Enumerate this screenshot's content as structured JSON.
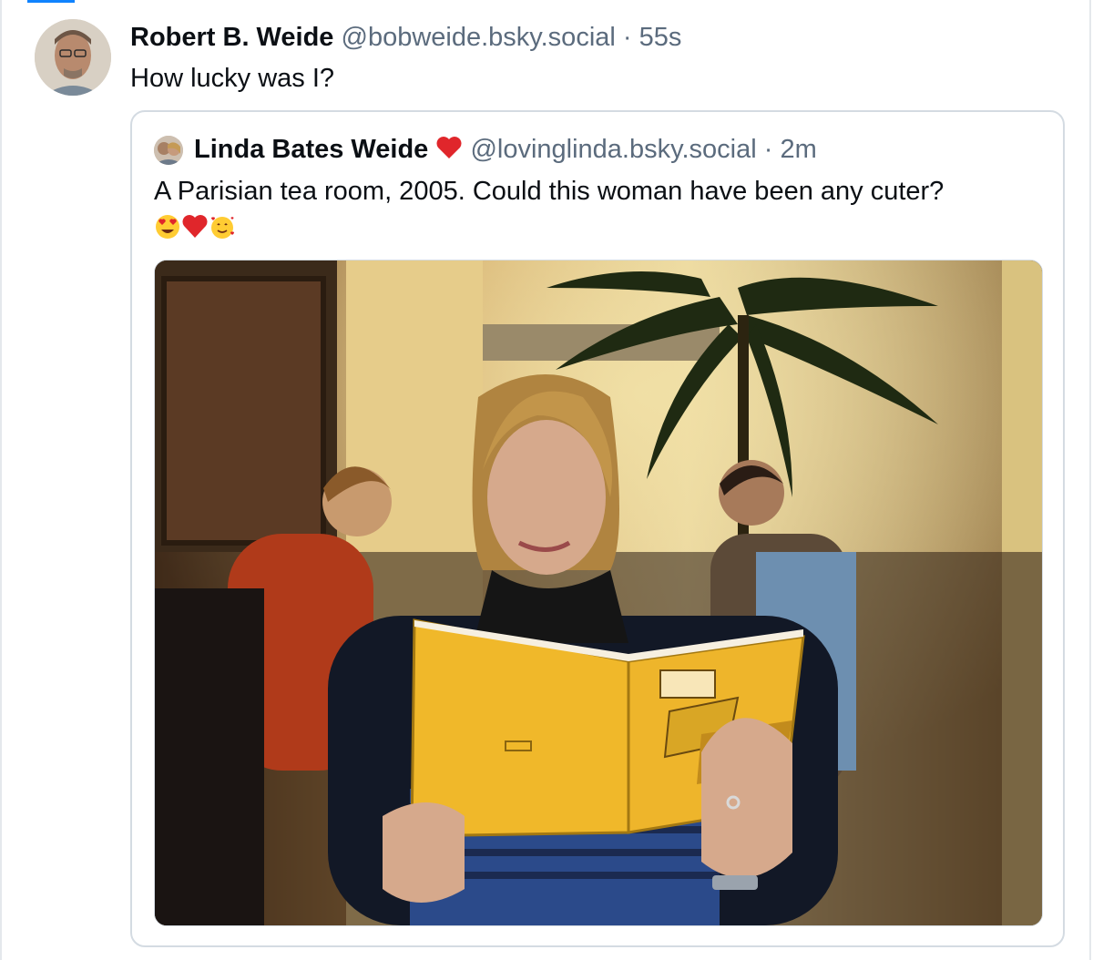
{
  "post": {
    "author_name": "Robert B. Weide",
    "handle": "@bobweide.bsky.social",
    "separator": "·",
    "time": "55s",
    "text": "How lucky was I?"
  },
  "quoted_post": {
    "author_name": "Linda Bates Weide",
    "name_emoji": "heart-icon",
    "handle": "@lovinglinda.bsky.social",
    "separator": "·",
    "time": "2m",
    "text": "A Parisian tea room, 2005. Could this woman have been any cuter?",
    "emojis": [
      "heart-eyes-emoji",
      "red-heart-emoji",
      "smiling-face-with-hearts-emoji"
    ]
  },
  "colors": {
    "accent": "#1083fe",
    "muted": "#5b6b7d",
    "border": "#d4dbe2",
    "heart": "#e0262b"
  }
}
